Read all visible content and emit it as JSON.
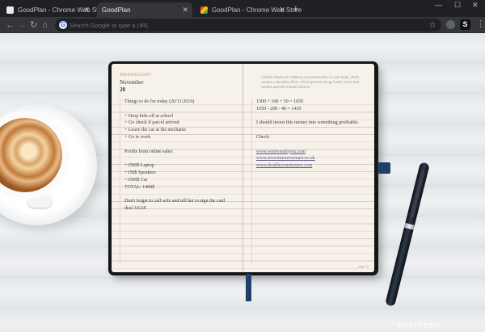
{
  "browser": {
    "tabs": [
      {
        "title": "GoodPlan - Chrome Web Store",
        "active": false
      },
      {
        "title": "GoodPlan",
        "active": true
      },
      {
        "title": "GoodPlan - Chrome Web Store",
        "active": false
      }
    ],
    "omnibox_placeholder": "Search Google or type a URL",
    "window_controls": {
      "minimize": "—",
      "maximize": "☐",
      "close": "✕"
    },
    "profile_initial": "S"
  },
  "planner": {
    "weekday": "WEDNESDAY",
    "month": "November",
    "day": "20",
    "quote": "Caffeine blocks an inhibitory neurotransmitter in your brain, which causes a stimulant effect. This improves energy levels, mood and various aspects of brain function.",
    "left_lines": [
      "Things to do for today (20/11/2019)",
      "",
      "+ Drop kids off at school",
      "+ Go check if parcel arrived",
      "+ Leave the car at the mechanic",
      "+ Go to work",
      "",
      "Profits from online sales:",
      "",
      "+1500$ Laptop",
      "+150$ Speakers",
      "+1500$ Car",
      "TOTAL: 1460$",
      "",
      "Don't forget to call wife and tell her to sign the card",
      "deal ASAP.",
      "",
      "",
      "",
      "",
      "",
      "",
      ""
    ],
    "right_lines": [
      "1500 + 100 + 50 = 1650",
      "1650 - 200 - 40 = 1410",
      "",
      "I should invest this money into something profitable.",
      "",
      "Check:",
      "",
      "www.weinvestinyou.com",
      "www.investmoneysmart.co.uk",
      "www.doubleyourmoney.com",
      "",
      "",
      "",
      "",
      "",
      "",
      "",
      "",
      "",
      "",
      "",
      "",
      ""
    ],
    "link_indices": [
      7,
      8,
      9
    ],
    "page_number": "page 12"
  },
  "watermark": "SOFTPEDIA"
}
